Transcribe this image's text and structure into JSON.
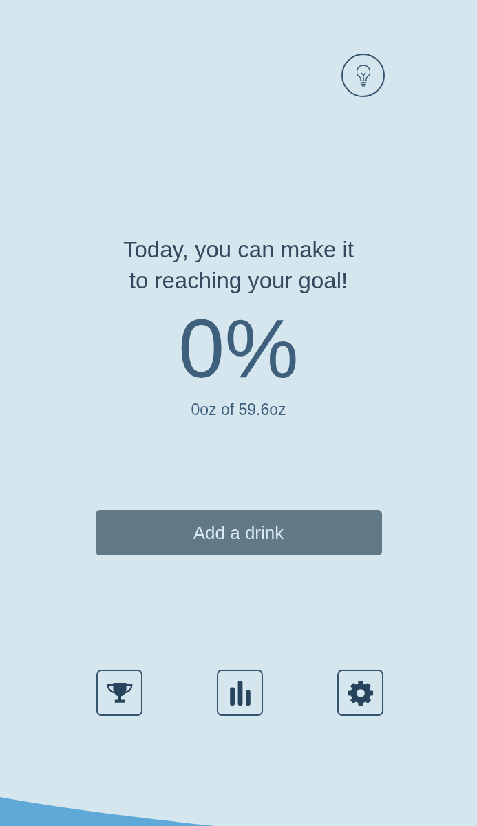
{
  "headline": "Today, you can make it to reaching your goal!",
  "progress": {
    "percent": "0%",
    "amount": "0oz of 59.6oz"
  },
  "add_button": {
    "label": "Add a drink"
  }
}
